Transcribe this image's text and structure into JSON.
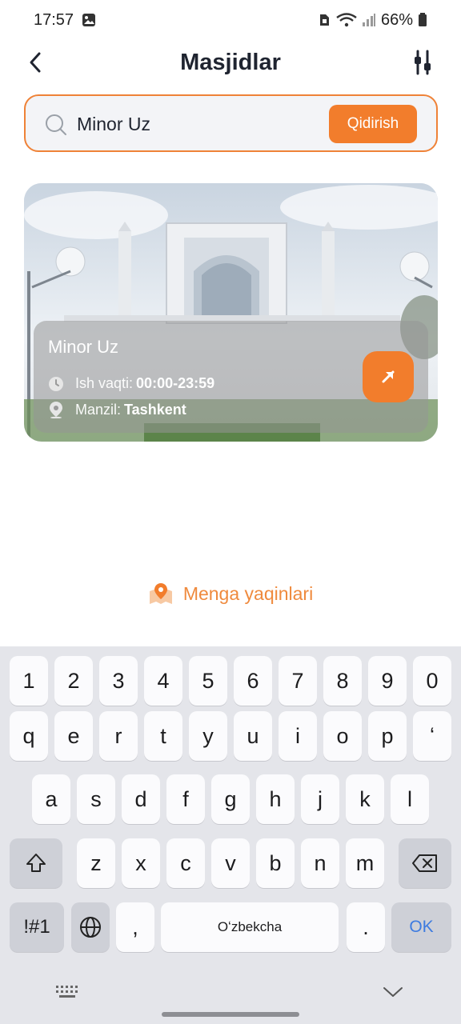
{
  "status_bar": {
    "time": "17:57",
    "battery": "66%"
  },
  "header": {
    "title": "Masjidlar"
  },
  "search": {
    "value": "Minor Uz",
    "button_label": "Qidirish"
  },
  "card": {
    "name": "Minor Uz",
    "hours_label": "Ish vaqti:",
    "hours_value": "00:00-23:59",
    "address_label": "Manzil:",
    "address_value": "Tashkent"
  },
  "nearby": {
    "label": "Menga yaqinlari"
  },
  "colors": {
    "accent": "#f27d2c",
    "title": "#1f2430"
  },
  "keyboard": {
    "row_numbers": [
      "1",
      "2",
      "3",
      "4",
      "5",
      "6",
      "7",
      "8",
      "9",
      "0"
    ],
    "row_top": [
      "q",
      "e",
      "r",
      "t",
      "y",
      "u",
      "i",
      "o",
      "p",
      "ʻ"
    ],
    "row_middle": [
      "a",
      "s",
      "d",
      "f",
      "g",
      "h",
      "j",
      "k",
      "l"
    ],
    "row_bottom": [
      "z",
      "x",
      "c",
      "v",
      "b",
      "n",
      "m"
    ],
    "symbols_label": "!#1",
    "comma_label": ",",
    "space_label": "Oʻzbekcha",
    "period_label": ".",
    "enter_label": "OK"
  }
}
